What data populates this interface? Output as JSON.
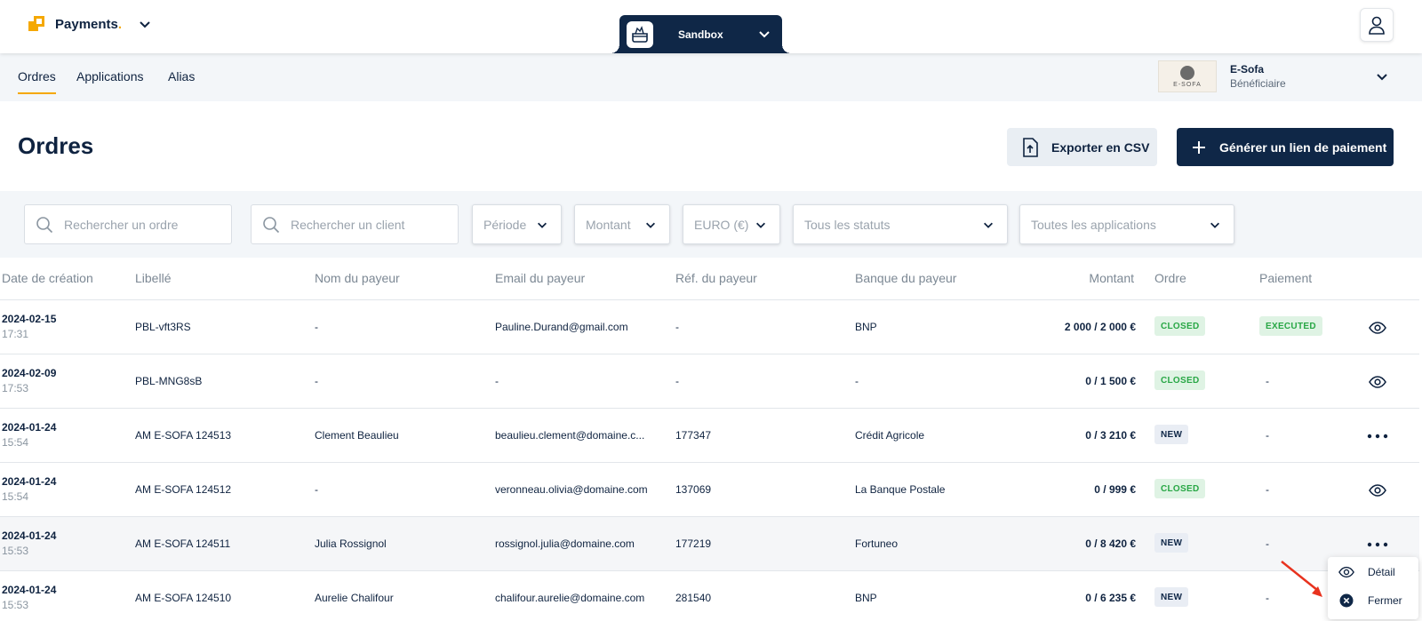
{
  "app": {
    "name": "Payments",
    "name_dot": "."
  },
  "environment": {
    "label": "Sandbox"
  },
  "nav": {
    "tabs": [
      "Ordres",
      "Applications",
      "Alias"
    ],
    "active": "Ordres"
  },
  "beneficiary": {
    "logo_text": "E-SOFA",
    "name": "E-Sofa",
    "role": "Bénéficiaire"
  },
  "page": {
    "title": "Ordres",
    "export_label": "Exporter en CSV",
    "generate_label": "Générer un lien de paiement"
  },
  "filters": {
    "search_order_placeholder": "Rechercher un ordre",
    "search_client_placeholder": "Rechercher un client",
    "period": "Période",
    "amount": "Montant",
    "currency": "EURO (€)",
    "status": "Tous les statuts",
    "applications": "Toutes les applications"
  },
  "table": {
    "headers": {
      "date": "Date de création",
      "label": "Libellé",
      "payer_name": "Nom du payeur",
      "payer_email": "Email du payeur",
      "payer_ref": "Réf. du payeur",
      "payer_bank": "Banque du payeur",
      "amount": "Montant",
      "order": "Ordre",
      "payment": "Paiement"
    },
    "rows": [
      {
        "date": "2024-02-15",
        "time": "17:31",
        "label": "PBL-vft3RS",
        "name": "-",
        "email": "Pauline.Durand@gmail.com",
        "ref": "-",
        "bank": "BNP",
        "amount": "2 000 / 2 000 €",
        "order": "CLOSED",
        "payment": "EXECUTED",
        "action": "eye"
      },
      {
        "date": "2024-02-09",
        "time": "17:53",
        "label": "PBL-MNG8sB",
        "name": "-",
        "email": "-",
        "ref": "-",
        "bank": "-",
        "amount": "0 / 1 500 €",
        "order": "CLOSED",
        "payment": "-",
        "action": "eye"
      },
      {
        "date": "2024-01-24",
        "time": "15:54",
        "label": "AM E-SOFA 124513",
        "name": "Clement Beaulieu",
        "email": "beaulieu.clement@domaine.c...",
        "ref": "177347",
        "bank": "Crédit Agricole",
        "amount": "0 / 3 210 €",
        "order": "NEW",
        "payment": "-",
        "action": "more"
      },
      {
        "date": "2024-01-24",
        "time": "15:54",
        "label": "AM E-SOFA 124512",
        "name": "-",
        "email": "veronneau.olivia@domaine.com",
        "ref": "137069",
        "bank": "La Banque Postale",
        "amount": "0 / 999 €",
        "order": "CLOSED",
        "payment": "-",
        "action": "eye"
      },
      {
        "date": "2024-01-24",
        "time": "15:53",
        "label": "AM E-SOFA 124511",
        "name": "Julia Rossignol",
        "email": "rossignol.julia@domaine.com",
        "ref": "177219",
        "bank": "Fortuneo",
        "amount": "0 / 8 420 €",
        "order": "NEW",
        "payment": "-",
        "action": "more"
      },
      {
        "date": "2024-01-24",
        "time": "15:53",
        "label": "AM E-SOFA 124510",
        "name": "Aurelie Chalifour",
        "email": "chalifour.aurelie@domaine.com",
        "ref": "281540",
        "bank": "BNP",
        "amount": "0 / 6 235 €",
        "order": "NEW",
        "payment": "-",
        "action": "none"
      }
    ]
  },
  "context_menu": {
    "detail": "Détail",
    "close": "Fermer"
  },
  "colors": {
    "navy": "#0f2747",
    "accent": "#f5a800",
    "success": "#28a745",
    "arrow": "#e8321e"
  }
}
